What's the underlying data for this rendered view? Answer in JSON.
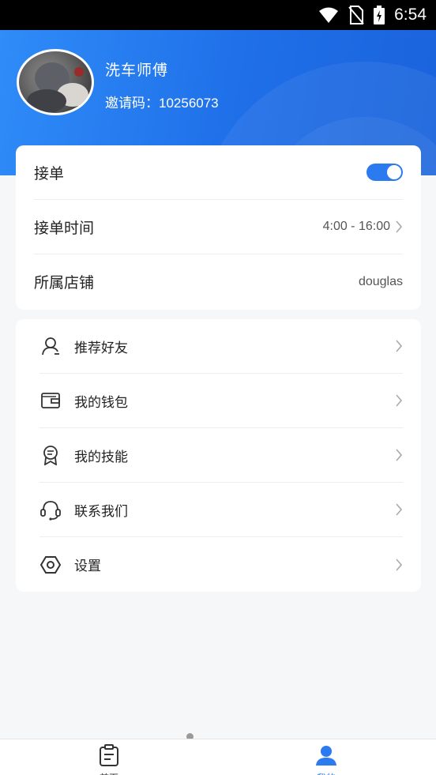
{
  "status_bar": {
    "time": "6:54"
  },
  "profile": {
    "name": "洗车师傅",
    "invite_label": "邀请码：",
    "invite_code": "10256073"
  },
  "settings_card": {
    "accept_orders": {
      "label": "接单",
      "enabled": true
    },
    "work_hours": {
      "label": "接单时间",
      "value": "4:00 - 16:00"
    },
    "store": {
      "label": "所属店铺",
      "value": "douglas"
    }
  },
  "menu": [
    {
      "label": "推荐好友",
      "icon": "user-icon"
    },
    {
      "label": "我的钱包",
      "icon": "wallet-icon"
    },
    {
      "label": "我的技能",
      "icon": "badge-icon"
    },
    {
      "label": "联系我们",
      "icon": "headset-icon"
    },
    {
      "label": "设置",
      "icon": "settings-icon"
    }
  ],
  "bottom_nav": {
    "home_label": "首页",
    "mine_label": "我的"
  },
  "colors": {
    "accent": "#2c7af0",
    "header_start": "#2f8cf8",
    "header_end": "#1a63dc"
  }
}
